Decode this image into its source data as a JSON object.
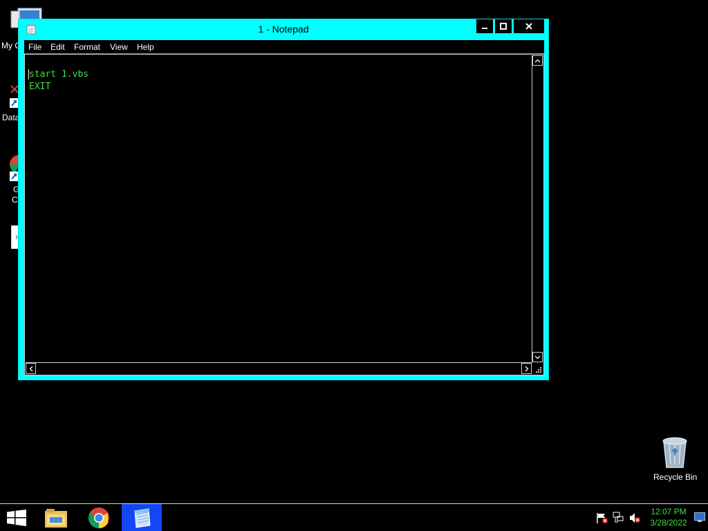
{
  "desktop": {
    "icons": [
      {
        "label": "My C",
        "icon": "computer-icon"
      },
      {
        "label": "Data",
        "icon": "shortcut-icon"
      },
      {
        "label": "G",
        "label2": "C",
        "icon": "chrome-shortcut-icon"
      },
      {
        "label": "",
        "icon": "document-icon"
      }
    ],
    "recycle_bin_label": "Recycle Bin"
  },
  "window": {
    "title": "1 - Notepad",
    "icon": "notepad-icon",
    "menu": [
      "File",
      "Edit",
      "Format",
      "View",
      "Help"
    ],
    "content_lines": [
      "start 1.vbs",
      "EXIT"
    ],
    "colors": {
      "frame": "#00ffff",
      "text": "#3fe03f",
      "background": "#000000"
    }
  },
  "taskbar": {
    "buttons": [
      "start-button",
      "file-explorer-icon",
      "chrome-icon",
      "notepad-icon"
    ],
    "clock_time": "12:07 PM",
    "clock_date": "3/28/2022",
    "tray_icons": [
      "action-center-flag-icon",
      "network-icon",
      "volume-muted-icon",
      "show-desktop-icon"
    ]
  }
}
